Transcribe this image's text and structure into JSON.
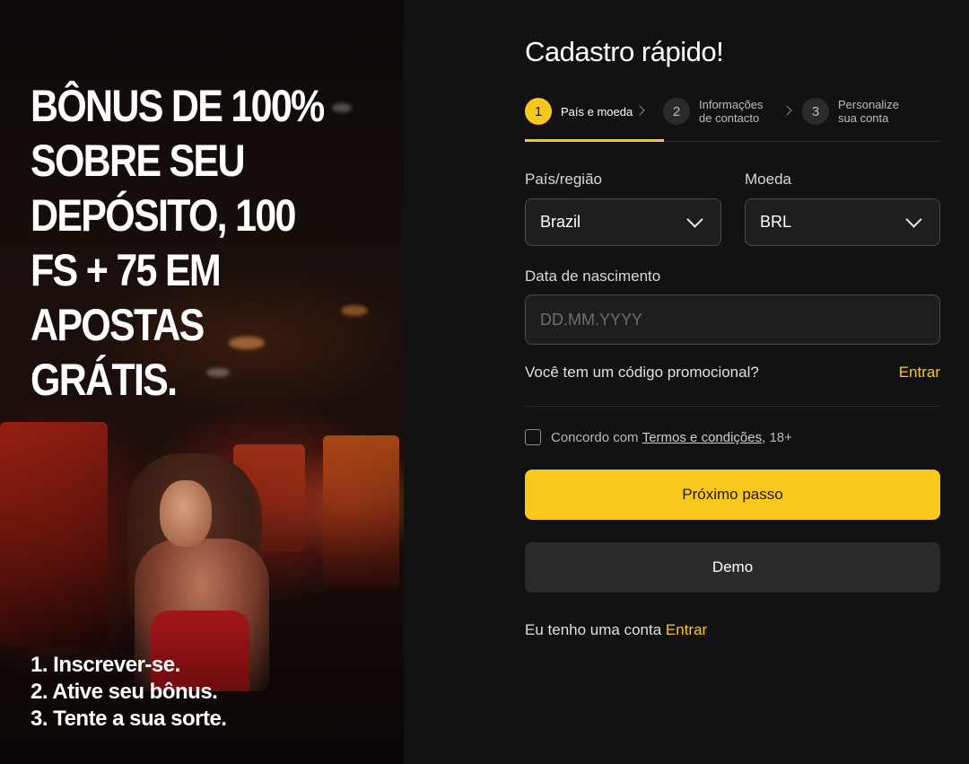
{
  "promo": {
    "headline": "BÔNUS DE 100% SOBRE SEU DEPÓSITO, 100 FS + 75 EM APOSTAS GRÁTIS.",
    "steps": [
      "1. Inscrever-se.",
      "2. Ative seu bônus.",
      "3. Tente a sua sorte."
    ]
  },
  "form": {
    "title": "Cadastro rápido!",
    "stepper": [
      {
        "number": "1",
        "label": "País e moeda",
        "active": true
      },
      {
        "number": "2",
        "label": "Informações de contacto",
        "active": false
      },
      {
        "number": "3",
        "label": "Personalize sua conta",
        "active": false
      }
    ],
    "country": {
      "label": "País/região",
      "value": "Brazil"
    },
    "currency": {
      "label": "Moeda",
      "value": "BRL"
    },
    "birthdate": {
      "label": "Data de nascimento",
      "placeholder": "DD.MM.YYYY"
    },
    "promo_code": {
      "question": "Você tem um código promocional?",
      "link": "Entrar"
    },
    "terms": {
      "prefix": "Concordo com",
      "link": "Termos e condições",
      "suffix": ", 18+",
      "checked": false
    },
    "next_button": "Próximo passo",
    "demo_button": "Demo",
    "login": {
      "prefix": "Eu tenho uma conta",
      "link": "Entrar"
    }
  },
  "colors": {
    "accent": "#f9c81c",
    "background": "#121212",
    "field": "#1e1e1e"
  }
}
